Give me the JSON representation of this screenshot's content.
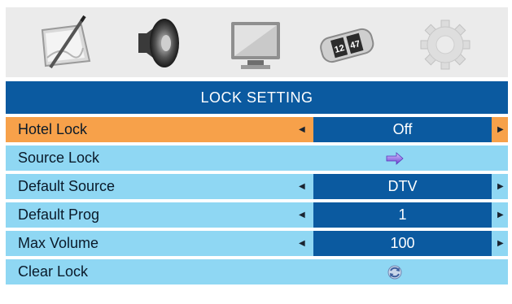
{
  "icons": [
    {
      "name": "picture-icon"
    },
    {
      "name": "sound-icon"
    },
    {
      "name": "screen-icon"
    },
    {
      "name": "time-icon",
      "digits_left": "12",
      "digits_right": "47"
    },
    {
      "name": "setup-gear-icon"
    }
  ],
  "header": {
    "title": "LOCK SETTING"
  },
  "rows": [
    {
      "label": "Hotel Lock",
      "value": "Off",
      "selected": true
    },
    {
      "label": "Source Lock",
      "icon": "arrow-right-icon"
    },
    {
      "label": "Default Source",
      "value": "DTV"
    },
    {
      "label": "Default Prog",
      "value": "1"
    },
    {
      "label": "Max Volume",
      "value": "100"
    },
    {
      "label": "Clear Lock",
      "icon": "refresh-icon"
    }
  ],
  "glyphs": {
    "left": "◀",
    "right": "▶"
  },
  "colors": {
    "header_bg": "#0b5aa0",
    "row_bg": "#8fd7f3",
    "selected_bg": "#f7a14a",
    "value_bg": "#0b5aa0",
    "icon_bar_bg": "#ebebeb"
  }
}
